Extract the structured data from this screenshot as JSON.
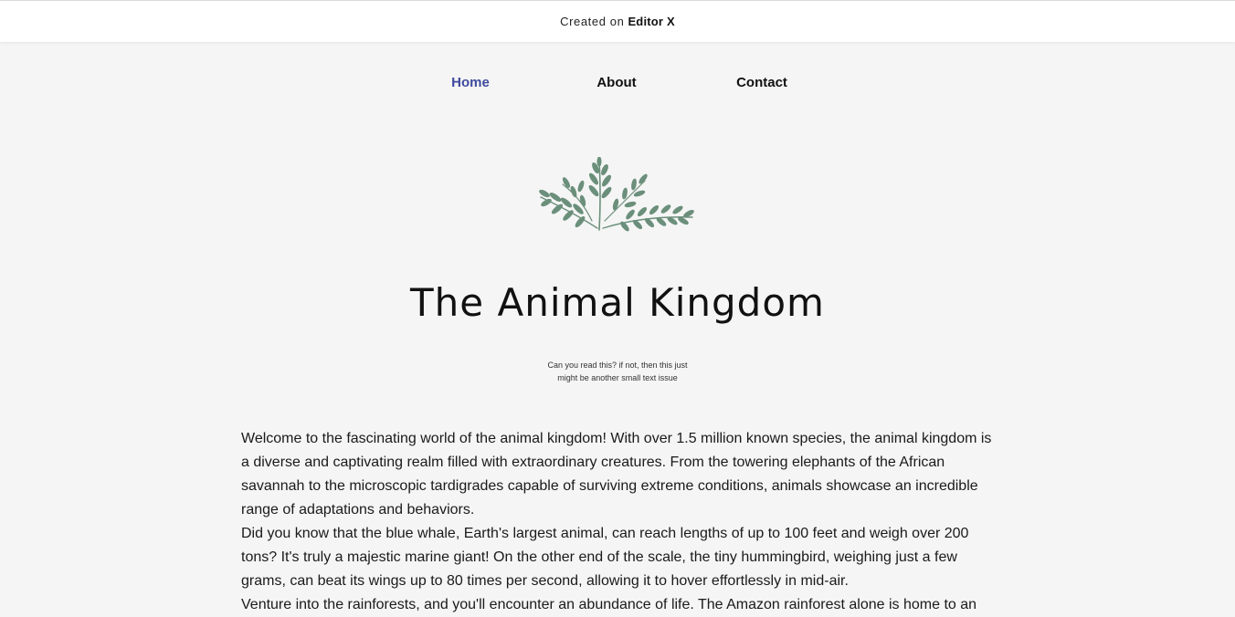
{
  "banner": {
    "prefix": "Created on",
    "brand": "Editor X"
  },
  "nav": {
    "items": [
      {
        "label": "Home",
        "active": true
      },
      {
        "label": "About",
        "active": false
      },
      {
        "label": "Contact",
        "active": false
      }
    ]
  },
  "logo": {
    "icon": "leaf-branch-icon",
    "color": "#6b8f7b"
  },
  "hero": {
    "title": "The Animal Kingdom",
    "subtitle_line1": "Can you read this? if not, then this just",
    "subtitle_line2": "might be another small text issue"
  },
  "content": {
    "paragraphs": [
      "Welcome to the fascinating world of the animal kingdom! With over 1.5 million known species, the animal kingdom is a diverse and captivating realm filled with extraordinary creatures. From the towering elephants of the African savannah to the microscopic tardigrades capable of surviving extreme conditions, animals showcase an incredible range of adaptations and behaviors.",
      "Did you know that the blue whale, Earth's largest animal, can reach lengths of up to 100 feet and weigh over 200 tons? It's truly a majestic marine giant! On the other end of the scale, the tiny hummingbird, weighing just a few grams, can beat its wings up to 80 times per second, allowing it to hover effortlessly in mid-air.",
      "Venture into the rainforests, and you'll encounter an abundance of life. The Amazon rainforest alone is home to an"
    ]
  },
  "colors": {
    "background": "#f5f5f5",
    "nav_active": "#3e4a9e",
    "text": "#111111"
  }
}
